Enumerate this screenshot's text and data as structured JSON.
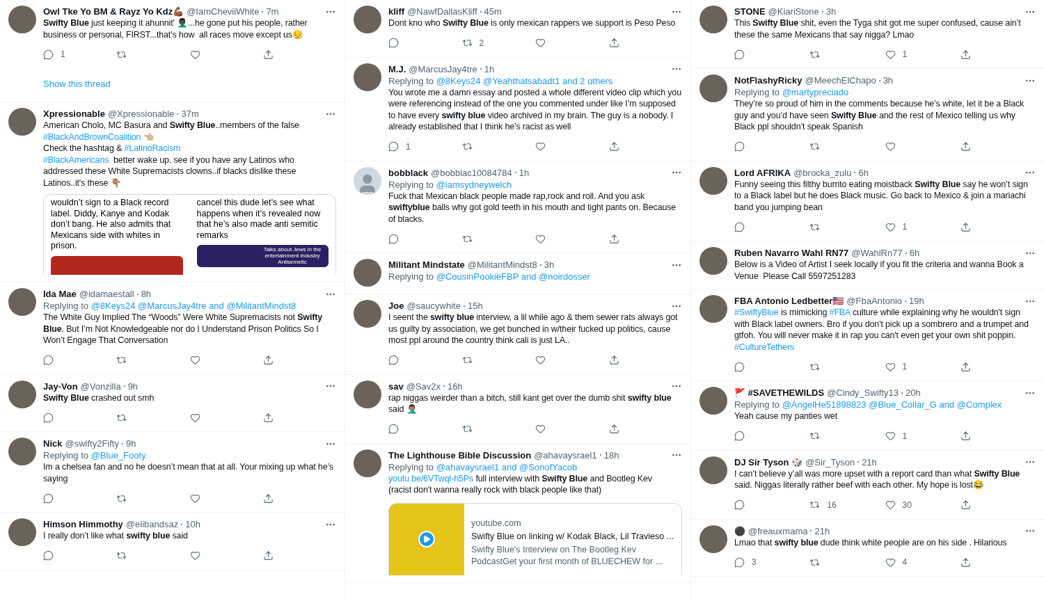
{
  "columns": [
    {
      "tweets": [
        {
          "default_avatar": false,
          "name": "Owl Tke Yo BM & Rayz Yo Kdz💪🏾",
          "handle": "@IamCheviiWhite",
          "time": "7m",
          "body": [
            {
              "kind": "bold",
              "text": "Swifty Blue"
            },
            {
              "kind": "text",
              "text": " just keeping it ahunnit' 🤦🏿‍♂️...he gone put his people, rather business or personal, FIRST...that's how  all races move except us😔"
            }
          ],
          "actions": [
            {
              "kind": "reply",
              "count": "1"
            },
            {
              "kind": "retweet"
            },
            {
              "kind": "like"
            },
            {
              "kind": "share"
            }
          ],
          "thread": "Show this thread"
        },
        {
          "default_avatar": false,
          "name": "Xpressionable",
          "handle": "@Xpressionable",
          "time": "37m",
          "body": [
            {
              "kind": "text",
              "text": "American Cholo, MC Basura and "
            },
            {
              "kind": "bold",
              "text": "Swifty Blue"
            },
            {
              "kind": "text",
              "text": "..members of the false\n"
            },
            {
              "kind": "link",
              "text": "#BlackAndBrownCoalition"
            },
            {
              "kind": "text",
              "text": " 👈🏼\nCheck the hashtag & "
            },
            {
              "kind": "link",
              "text": "#LatinoRacism"
            },
            {
              "kind": "link",
              "text": "\n#BlackAmericans"
            },
            {
              "kind": "text",
              "text": "  better wake up. see if you have any Latinos who addressed these White Supremacists clowns..if blacks dislike these Latinos..it's these 👇🏽"
            }
          ],
          "media": {
            "kind": "screenshots",
            "panels": [
              {
                "text": "wouldn’t sign to a Black record label. Diddy, Kanye and Kodak don’t bang. He also admits that Mexicans side with whites in prison."
              },
              {
                "text": "cancel this dude let’s see what happens when it’s revealed now that he’s also made anti semitic remarks",
                "image_text": "Talks about Jews in the entertainment industry Antisemetic"
              }
            ]
          }
        },
        {
          "default_avatar": false,
          "name": "Ida Mae",
          "handle": "@idamaestall",
          "time": "8h",
          "reply_label": "Replying to",
          "reply_to": "@8Keys24 @MarcusJay4tre and @MilitantMindst8",
          "body": [
            {
              "kind": "text",
              "text": "The White Guy Implied The “Woods” Were White Supremacists not "
            },
            {
              "kind": "bold",
              "text": "Swifty Blue"
            },
            {
              "kind": "text",
              "text": ". But I’m Not Knowledgeable nor do I Understand Prison Politics So I Won’t Engage That Conversation"
            }
          ],
          "actions": [
            {
              "kind": "reply"
            },
            {
              "kind": "retweet"
            },
            {
              "kind": "like"
            },
            {
              "kind": "share"
            }
          ]
        },
        {
          "default_avatar": false,
          "name": "Jay-Von",
          "handle": "@Vonzilla",
          "time": "9h",
          "body": [
            {
              "kind": "bold",
              "text": "Swifty Blue"
            },
            {
              "kind": "text",
              "text": " crashed out smh"
            }
          ],
          "actions": [
            {
              "kind": "reply"
            },
            {
              "kind": "retweet"
            },
            {
              "kind": "like"
            },
            {
              "kind": "share"
            }
          ]
        },
        {
          "default_avatar": false,
          "name": "Nick",
          "handle": "@swifty2Fifty",
          "time": "9h",
          "reply_label": "Replying to",
          "reply_to": "@Blue_Footy",
          "body": [
            {
              "kind": "text",
              "text": "Im a chelsea fan and no he doesn’t mean that at all. Your mixing up what he’s saying"
            }
          ],
          "actions": [
            {
              "kind": "reply"
            },
            {
              "kind": "retweet"
            },
            {
              "kind": "like"
            },
            {
              "kind": "share"
            }
          ]
        },
        {
          "default_avatar": false,
          "name": "Himson Himmothy",
          "handle": "@elibandsaz",
          "time": "10h",
          "body": [
            {
              "kind": "text",
              "text": "I really don’t like what "
            },
            {
              "kind": "bold",
              "text": "swifty blue"
            },
            {
              "kind": "text",
              "text": " said"
            }
          ],
          "actions": [
            {
              "kind": "reply"
            },
            {
              "kind": "retweet"
            },
            {
              "kind": "like"
            },
            {
              "kind": "share"
            }
          ]
        }
      ]
    },
    {
      "tweets": [
        {
          "default_avatar": false,
          "name": "kliff",
          "handle": "@NawfDallasKliff",
          "time": "45m",
          "body": [
            {
              "kind": "text",
              "text": "Dont kno who "
            },
            {
              "kind": "bold",
              "text": "Swifty Blue"
            },
            {
              "kind": "text",
              "text": " is only mexican rappers we support is Peso Peso"
            }
          ],
          "actions": [
            {
              "kind": "reply"
            },
            {
              "kind": "retweet",
              "count": "2"
            },
            {
              "kind": "like"
            },
            {
              "kind": "share"
            }
          ]
        },
        {
          "default_avatar": false,
          "name": "M.J.",
          "handle": "@MarcusJay4tre",
          "time": "1h",
          "reply_label": "Replying to",
          "reply_to": "@8Keys24 @Yeahthatsabadt1 and 2 others",
          "body": [
            {
              "kind": "text",
              "text": "You wrote me a damn essay and posted a whole different video clip which you were referencing instead of the one you commented under like I’m supposed to have every "
            },
            {
              "kind": "bold",
              "text": "swifty blue"
            },
            {
              "kind": "text",
              "text": " video archived in my brain. The guy is a nobody. I already established that I think he’s racist as well"
            }
          ],
          "actions": [
            {
              "kind": "reply",
              "count": "1"
            },
            {
              "kind": "retweet"
            },
            {
              "kind": "like"
            },
            {
              "kind": "share"
            }
          ]
        },
        {
          "default_avatar": true,
          "name": "bobblack",
          "handle": "@bobblac10084784",
          "time": "1h",
          "reply_label": "Replying to",
          "reply_to": "@iamsydneywelch",
          "body": [
            {
              "kind": "text",
              "text": "Fuck that Mexican black people made rap,rock and roll. And you ask "
            },
            {
              "kind": "bold",
              "text": "swiftyblue"
            },
            {
              "kind": "text",
              "text": " balls why got gold teeth in his mouth and tight pants on. Because of blacks."
            }
          ],
          "actions": [
            {
              "kind": "reply"
            },
            {
              "kind": "retweet"
            },
            {
              "kind": "like"
            },
            {
              "kind": "share"
            }
          ]
        },
        {
          "default_avatar": false,
          "name": "Militant Mindstate",
          "handle": "@MilitantMindst8",
          "time": "3h",
          "reply_label": "Replying to",
          "reply_to": "@CousinPookieFBP and @noirdosser"
        },
        {
          "default_avatar": false,
          "name": "Joe",
          "handle": "@saucywhite",
          "time": "15h",
          "body": [
            {
              "kind": "text",
              "text": "I seent the "
            },
            {
              "kind": "bold",
              "text": "swifty blue"
            },
            {
              "kind": "text",
              "text": " interview, a lil while ago & them sewer rats always got us guilty by association, we get bunched in w/their fucked up politics, cause most ppl around the country think cali is just LA.."
            }
          ],
          "actions": [
            {
              "kind": "reply"
            },
            {
              "kind": "retweet"
            },
            {
              "kind": "like"
            },
            {
              "kind": "share"
            }
          ]
        },
        {
          "default_avatar": false,
          "name": "sav",
          "handle": "@Sav2x",
          "time": "16h",
          "body": [
            {
              "kind": "text",
              "text": "rap niggas weirder than a bitch, still kant get over the dumb shit "
            },
            {
              "kind": "bold",
              "text": "swifty blue"
            },
            {
              "kind": "text",
              "text": " said 🤦🏽‍♂️"
            }
          ],
          "actions": [
            {
              "kind": "reply"
            },
            {
              "kind": "retweet"
            },
            {
              "kind": "like"
            },
            {
              "kind": "share"
            }
          ]
        },
        {
          "default_avatar": false,
          "name": "The Lighthouse Bible Discussion",
          "handle": "@ahavaysrael1",
          "time": "18h",
          "reply_label": "Replying to",
          "reply_to": "@ahavaysrael1 and @SonofYacob",
          "body": [
            {
              "kind": "link",
              "text": "youtu.be/6VTwql-h5Ps"
            },
            {
              "kind": "text",
              "text": " full interview with "
            },
            {
              "kind": "bold",
              "text": "Swifty Blue"
            },
            {
              "kind": "text",
              "text": " and Bootleg Kev\n(racist don't wanna really rock with black people like that)"
            }
          ],
          "media": {
            "kind": "link_card",
            "domain": "youtube.com",
            "title": "Swifty Blue on linking w/ Kodak Black, Lil Travieso ...",
            "description": "Swifty Blue's Interview on The Bootleg Kev PodcastGet your first month of BLUECHEW for ..."
          }
        }
      ]
    },
    {
      "tweets": [
        {
          "default_avatar": false,
          "name": "STONE",
          "handle": "@KiariStone",
          "time": "3h",
          "body": [
            {
              "kind": "text",
              "text": "This "
            },
            {
              "kind": "bold",
              "text": "Swifty Blue"
            },
            {
              "kind": "text",
              "text": " shit, even the Tyga shit got me super confused, cause ain’t these the same Mexicans that say nigga? Lmao"
            }
          ],
          "actions": [
            {
              "kind": "reply"
            },
            {
              "kind": "retweet"
            },
            {
              "kind": "like",
              "count": "1"
            },
            {
              "kind": "share"
            }
          ]
        },
        {
          "default_avatar": false,
          "name": "NotFlashyRicky",
          "handle": "@MeechElChapo",
          "time": "3h",
          "reply_label": "Replying to",
          "reply_to": "@martypreciado",
          "body": [
            {
              "kind": "text",
              "text": "They’re so proud of him in the comments because he’s white, let it be a Black guy and you’d have seen "
            },
            {
              "kind": "bold",
              "text": "Swifty Blue"
            },
            {
              "kind": "text",
              "text": " and the rest of Mexico telling us why Black ppl shouldn’t speak Spanish"
            }
          ],
          "actions": [
            {
              "kind": "reply"
            },
            {
              "kind": "retweet"
            },
            {
              "kind": "like"
            },
            {
              "kind": "share"
            }
          ]
        },
        {
          "default_avatar": false,
          "name": "Lord AFRIKA",
          "handle": "@brocka_zulu",
          "time": "6h",
          "body": [
            {
              "kind": "text",
              "text": "Funny seeing this filthy burrito eating moistback "
            },
            {
              "kind": "bold",
              "text": "Swifty Blue"
            },
            {
              "kind": "text",
              "text": " say he won’t sign to a Black label but he does Black music. Go back to Mexico & join a mariachi band you jumping bean"
            }
          ],
          "actions": [
            {
              "kind": "reply"
            },
            {
              "kind": "retweet"
            },
            {
              "kind": "like",
              "count": "1"
            },
            {
              "kind": "share"
            }
          ]
        },
        {
          "default_avatar": false,
          "name": "Ruben Navarro Wahl RN77",
          "handle": "@WahlRn77",
          "time": "6h",
          "body": [
            {
              "kind": "text",
              "text": "Below is a Video of Artist I seek locally if you fit the criteria and wanna Book a  Venue  Please Call 5597251283"
            }
          ]
        },
        {
          "default_avatar": false,
          "name": "FBA Antonio Ledbetter🇺🇸",
          "handle": "@FbaAntonio",
          "time": "19h",
          "body": [
            {
              "kind": "link",
              "text": "#SwiftyBlue"
            },
            {
              "kind": "text",
              "text": " is mimicking "
            },
            {
              "kind": "link",
              "text": "#FBA"
            },
            {
              "kind": "text",
              "text": " culture while explaining why he wouldn't sign with Black label owners. Bro if you don't pick up a sombrero and a trumpet and gtfoh. You will never make it in rap you can't even get your own shit poppin. "
            },
            {
              "kind": "link",
              "text": "#CultureTethers"
            }
          ],
          "actions": [
            {
              "kind": "reply"
            },
            {
              "kind": "retweet"
            },
            {
              "kind": "like",
              "count": "1"
            },
            {
              "kind": "share"
            }
          ]
        },
        {
          "default_avatar": false,
          "name": "🚩 #SAVETHEWILDS",
          "handle": "@Cindy_Swifty13",
          "time": "20h",
          "reply_label": "Replying to",
          "reply_to": "@AngelHe51898823 @Blue_Collar_G and @Complex",
          "body": [
            {
              "kind": "text",
              "text": "Yeah cause my panties wet"
            }
          ],
          "actions": [
            {
              "kind": "reply"
            },
            {
              "kind": "retweet"
            },
            {
              "kind": "like",
              "count": "1"
            },
            {
              "kind": "share"
            }
          ]
        },
        {
          "default_avatar": false,
          "name": "DJ Sir Tyson 🎲",
          "handle": "@Sir_Tyson",
          "time": "21h",
          "body": [
            {
              "kind": "text",
              "text": "I can’t believe y’all was more upset with a report card than what "
            },
            {
              "kind": "bold",
              "text": "Swifty Blue"
            },
            {
              "kind": "text",
              "text": " said. Niggas literally rather beef with each other. My hope is lost😂"
            }
          ],
          "actions": [
            {
              "kind": "reply"
            },
            {
              "kind": "retweet",
              "count": "16"
            },
            {
              "kind": "like",
              "count": "30"
            },
            {
              "kind": "share"
            }
          ]
        },
        {
          "default_avatar": false,
          "name": "⚫",
          "handle": "@freauxmama",
          "time": "21h",
          "body": [
            {
              "kind": "text",
              "text": "Lmao that "
            },
            {
              "kind": "bold",
              "text": "swifty blue"
            },
            {
              "kind": "text",
              "text": " dude think white people are on his side . Hilarious"
            }
          ],
          "actions": [
            {
              "kind": "reply",
              "count": "3"
            },
            {
              "kind": "retweet"
            },
            {
              "kind": "like",
              "count": "4"
            },
            {
              "kind": "share"
            }
          ]
        }
      ]
    }
  ]
}
